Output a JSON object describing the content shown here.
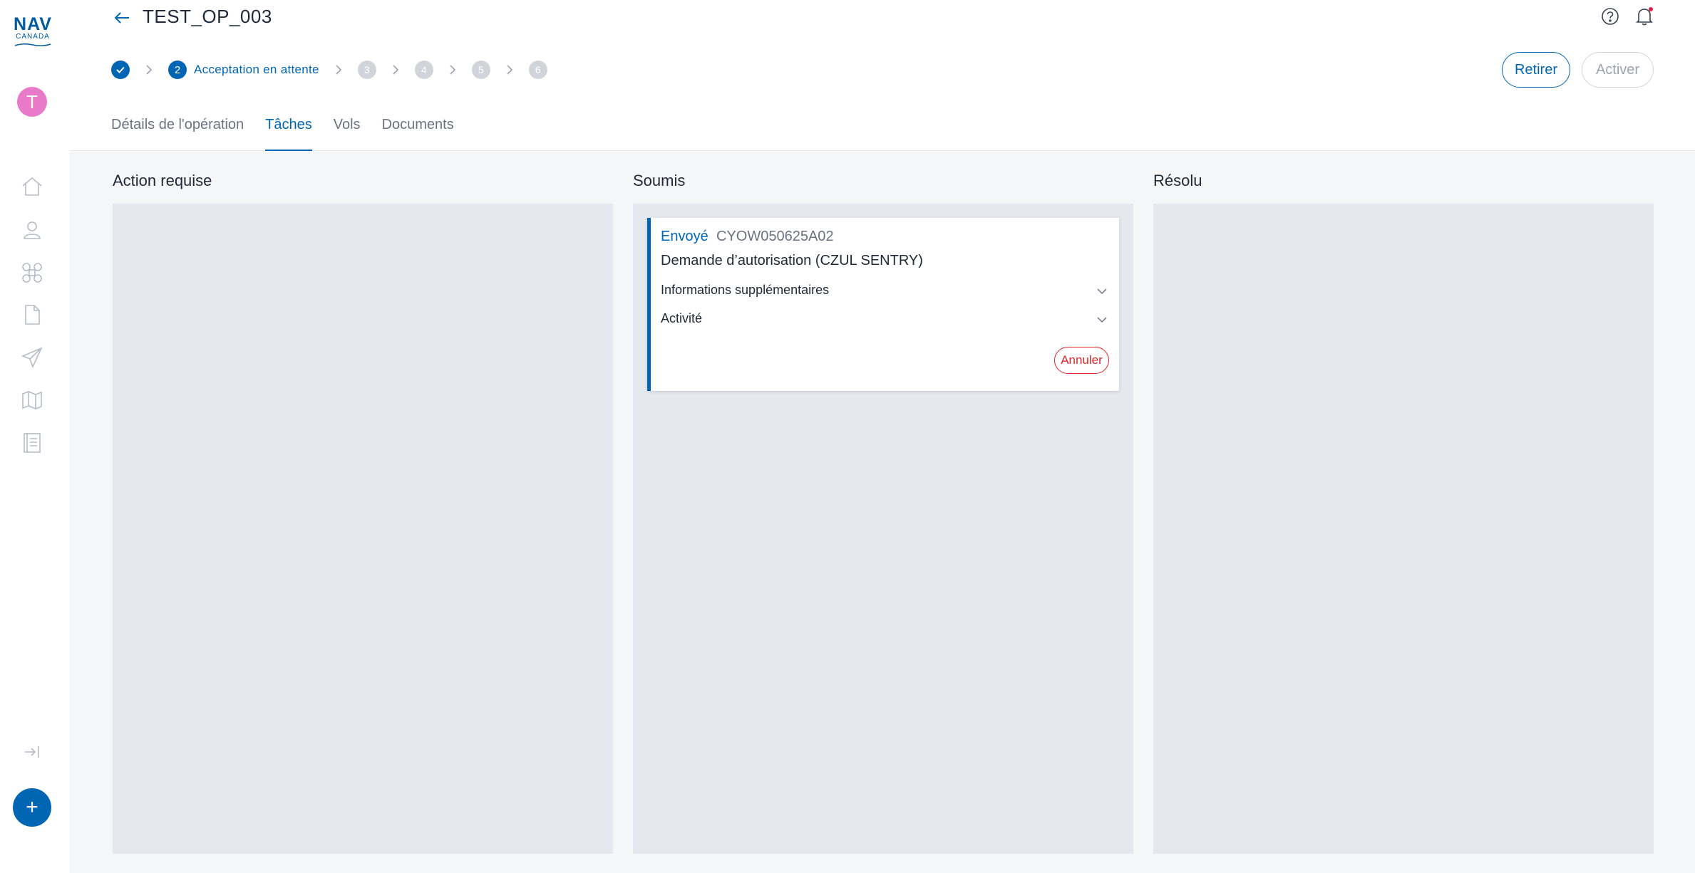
{
  "app": {
    "logo_primary": "NAV",
    "logo_secondary": "CANADA",
    "avatar_initial": "T",
    "fab_symbol": "+"
  },
  "sidebar": {
    "items": [
      {
        "icon": "home-icon"
      },
      {
        "icon": "user-icon"
      },
      {
        "icon": "drone-icon"
      },
      {
        "icon": "document-icon"
      },
      {
        "icon": "paper-plane-icon"
      },
      {
        "icon": "map-icon"
      },
      {
        "icon": "logbook-icon"
      }
    ],
    "collapse_icon": "expand-sidebar-icon"
  },
  "header": {
    "title": "TEST_OP_003",
    "help_icon": "help-icon",
    "notifications_icon": "bell-icon",
    "stepper": {
      "active_number": "2",
      "active_label": "Acceptation en attente",
      "future_steps": [
        "3",
        "4",
        "5",
        "6"
      ]
    },
    "retirer_label": "Retirer",
    "activer_label": "Activer",
    "tabs": [
      {
        "label": "Détails de l'opération",
        "active": false
      },
      {
        "label": "Tâches",
        "active": true
      },
      {
        "label": "Vols",
        "active": false
      },
      {
        "label": "Documents",
        "active": false
      }
    ]
  },
  "board": {
    "columns": [
      {
        "title": "Action requise"
      },
      {
        "title": "Soumis"
      },
      {
        "title": "Résolu"
      }
    ],
    "card": {
      "status": "Envoyé",
      "reference": "CYOW050625A02",
      "title": "Demande d’autorisation (CZUL SENTRY)",
      "section_1": "Informations supplémentaires",
      "section_2": "Activité",
      "cancel_label": "Annuler"
    }
  },
  "colors": {
    "accent": "#0066b3",
    "danger": "#dc2626",
    "avatar": "#e87ac9",
    "column_bg": "#e5e8ef"
  }
}
